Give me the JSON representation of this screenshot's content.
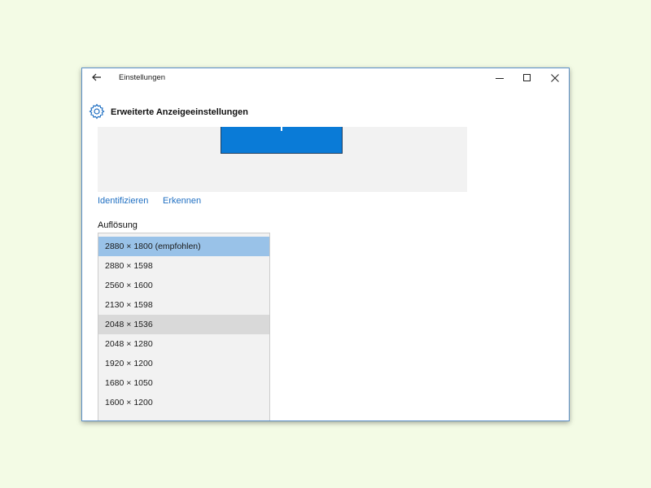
{
  "window": {
    "title": "Einstellungen"
  },
  "page": {
    "title": "Erweiterte Anzeigeeinstellungen"
  },
  "links": {
    "identify": "Identifizieren",
    "detect": "Erkennen"
  },
  "resolution": {
    "label": "Auflösung",
    "options": [
      "2880 × 1800 (empfohlen)",
      "2880 × 1598",
      "2560 × 1600",
      "2130 × 1598",
      "2048 × 1536",
      "2048 × 1280",
      "1920 × 1200",
      "1680 × 1050",
      "1600 × 1200"
    ],
    "selected_index": 0,
    "hovered_index": 4
  },
  "colors": {
    "accent": "#0a7bd7",
    "link": "#1f6fc2",
    "selected": "#99c2e8",
    "hover": "#d9d9d9",
    "background": "#f3fbe5"
  },
  "icons": {
    "back": "arrow-left-icon",
    "settings": "gear-icon",
    "minimize": "minimize-icon",
    "maximize": "maximize-icon",
    "close": "close-icon"
  }
}
